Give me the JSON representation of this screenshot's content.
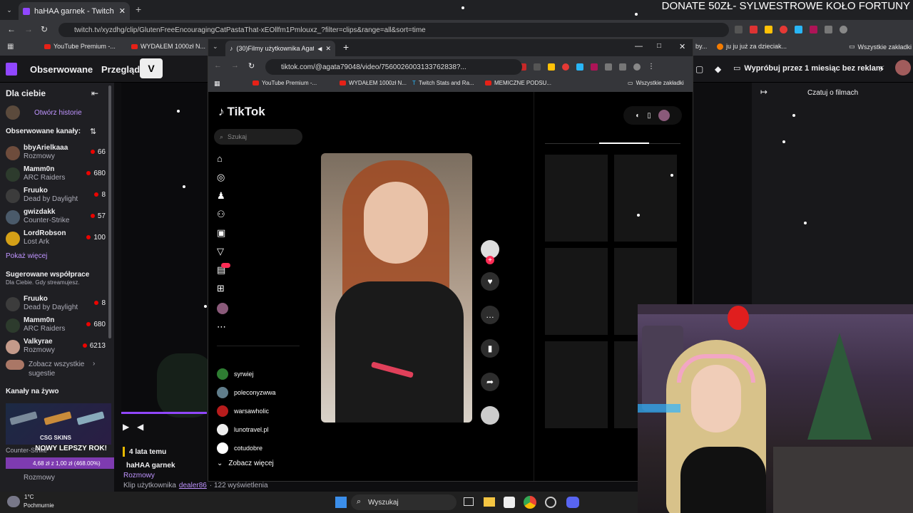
{
  "donate_banner": "DONATE 50ZŁ- SYLWESTROWE KOŁO FORTUNY",
  "outer_browser": {
    "tab_title": "haHAA garnek - Twitch",
    "url": "twitch.tv/xyzdhg/clip/GlutenFreeEncouragingCatPastaThat-xEOllfm1Pmlouxz_?filter=clips&range=all&sort=time",
    "bookmarks": [
      "YouTube Premium -...",
      "WYDAŁEM 1000zł N...",
      "by...",
      "ju ju już za dzieciak...",
      "Wszystkie zakładki"
    ]
  },
  "twitch": {
    "nav_followed": "Obserwowane",
    "nav_browse": "Przegląda",
    "promo": "Wypróbuj przez 1 miesiąc bez reklam",
    "sidebar_title": "Dla ciebie",
    "open_history": "Otwórz historie",
    "followed_header": "Obserwowane kanały:",
    "followed": [
      {
        "name": "bbyArielkaaa",
        "game": "Rozmowy",
        "viewers": "66"
      },
      {
        "name": "Mamm0n",
        "game": "ARC Raiders",
        "viewers": "680"
      },
      {
        "name": "Fruuko",
        "game": "Dead by Daylight",
        "viewers": "8"
      },
      {
        "name": "gwizdakk",
        "game": "Counter-Strike",
        "viewers": "57"
      },
      {
        "name": "LordRobson",
        "game": "Lost Ark",
        "viewers": "100"
      }
    ],
    "show_more": "Pokaż więcej",
    "suggested_header": "Sugerowane współprace",
    "suggested_sub": "Dla Ciebie. Gdy streamujesz.",
    "suggested": [
      {
        "name": "Fruuko",
        "game": "Dead by Daylight",
        "viewers": "8"
      },
      {
        "name": "Mamm0n",
        "game": "ARC Raiders",
        "viewers": "680"
      },
      {
        "name": "Valkyrae",
        "game": "Rozmowy",
        "viewers": "6213"
      }
    ],
    "see_all": "Zobacz wszystkie sugestie",
    "live_header": "Kanały na żywo",
    "ad_text": "CSG SKINS",
    "ad_promo": "NOWY LEPSZY ROK!",
    "ad_price": "4,68 zł z 1,00 zł (468.00%)",
    "live_partial": [
      {
        "game": "Counter-Strike"
      },
      {
        "game": "Rozmowy"
      }
    ],
    "clip_age": "4 lata temu",
    "clip_title": "haHAA garnek",
    "clip_category": "Rozmowy",
    "clip_meta_prefix": "Klip użytkownika",
    "clip_author": "dealer86",
    "clip_views": "· 122 wyświetlenia",
    "chat_label": "Czatuj o filmach"
  },
  "inner_browser": {
    "tab_title": "(30)Filmy użytkownika Agat",
    "url": "tiktok.com/@agata79048/video/7560026003133762838?...",
    "bookmarks": [
      "YouTube Premium -...",
      "WYDAŁEM 1000zł N...",
      "Twitch Stats and Ra...",
      "MEMICZNE PODSU...",
      "Wszystkie zakładki"
    ]
  },
  "tiktok": {
    "logo": "TikTok",
    "search_placeholder": "Szukaj",
    "accounts": [
      "syrwiej",
      "poleconyzwwa",
      "warsawholic",
      "lunotravel.pl",
      "cotudobre"
    ],
    "see_more": "Zobacz więcej"
  },
  "weather": {
    "temp": "1°C",
    "desc": "Pochmurnie"
  },
  "taskbar_search": "Wyszukaj",
  "colors": {
    "twitch_purple": "#9147ff",
    "tiktok_red": "#fe2c55",
    "live_red": "#eb0400"
  }
}
